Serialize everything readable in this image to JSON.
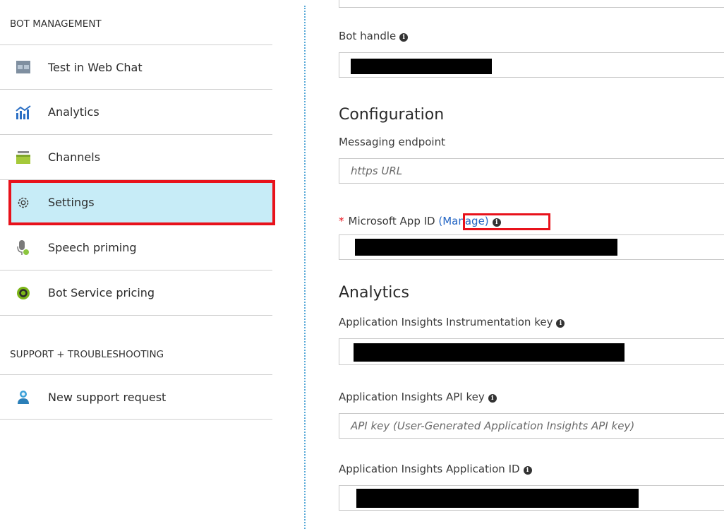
{
  "sidebar": {
    "section1": "BOT MANAGEMENT",
    "items": [
      {
        "label": "Test in Web Chat",
        "icon": "web-chat-icon"
      },
      {
        "label": "Analytics",
        "icon": "analytics-icon"
      },
      {
        "label": "Channels",
        "icon": "channels-icon"
      },
      {
        "label": "Settings",
        "icon": "gear-icon"
      },
      {
        "label": "Speech priming",
        "icon": "speech-icon"
      },
      {
        "label": "Bot Service pricing",
        "icon": "pricing-icon"
      }
    ],
    "section2": "SUPPORT + TROUBLESHOOTING",
    "support_items": [
      {
        "label": "New support request",
        "icon": "support-person-icon"
      }
    ]
  },
  "content": {
    "bot_handle_label": "Bot handle",
    "configuration_heading": "Configuration",
    "messaging_endpoint_label": "Messaging endpoint",
    "messaging_endpoint_placeholder": "https URL",
    "app_id_required": "*",
    "app_id_label": "Microsoft App ID",
    "manage_link": "(Manage)",
    "analytics_heading": "Analytics",
    "instrumentation_key_label": "Application Insights Instrumentation key",
    "api_key_label": "Application Insights API key",
    "api_key_placeholder": "API key (User-Generated Application Insights API key)",
    "app_insights_id_label": "Application Insights Application ID",
    "info_glyph": "i"
  },
  "colors": {
    "selected_bg": "#c7ecf7",
    "highlight_red": "#e8121b",
    "link_blue": "#2466c4"
  }
}
